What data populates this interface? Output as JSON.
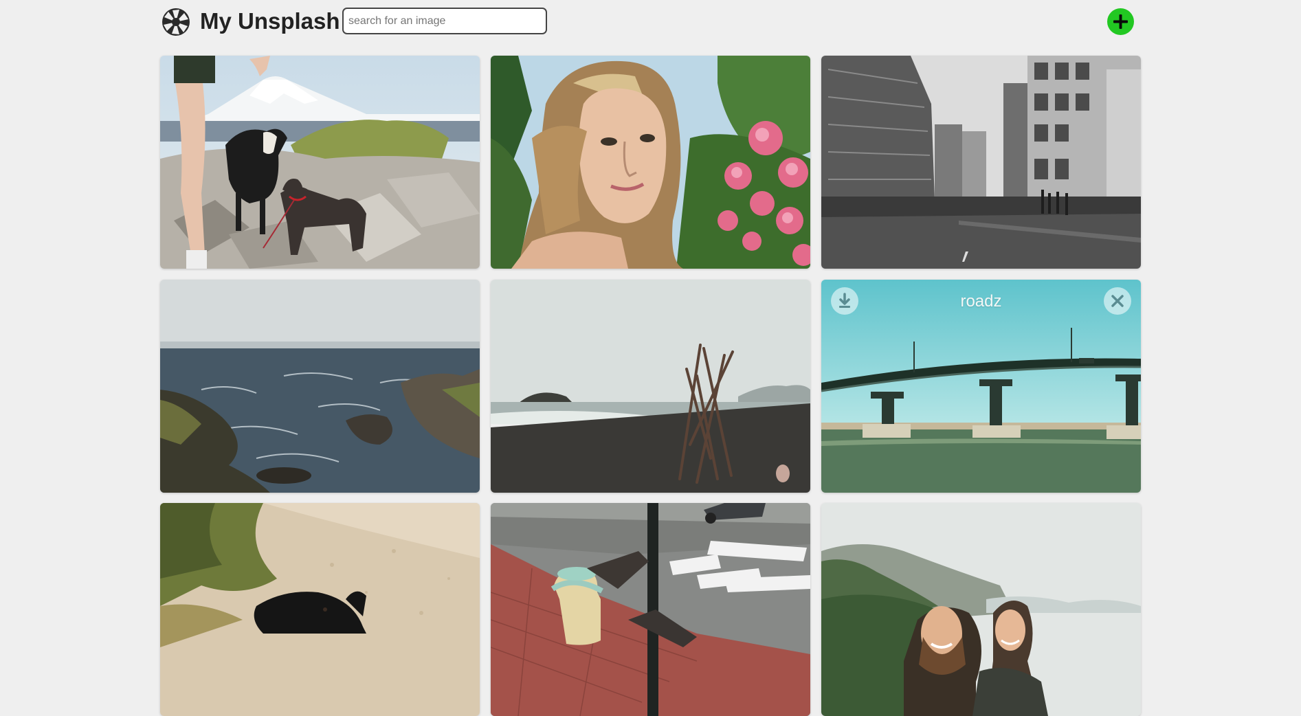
{
  "header": {
    "title": "My Unsplash",
    "search_placeholder": "search for an image",
    "search_value": "",
    "add_icon": "plus-icon",
    "logo_icon": "camera-aperture-icon"
  },
  "colors": {
    "background": "#efefef",
    "add_button": "#22c822",
    "title": "#222222"
  },
  "gallery": {
    "images": [
      {
        "subject": "woman legs with two dogs on rocks, snowy mountain"
      },
      {
        "subject": "portrait of woman with pink flowers"
      },
      {
        "subject": "black and white city street"
      },
      {
        "subject": "rocky ocean coastline"
      },
      {
        "subject": "driftwood teepee on dark beach"
      },
      {
        "subject": "bridge over water",
        "label": "roadz",
        "hovered": true
      },
      {
        "subject": "black dog on dirt path"
      },
      {
        "subject": "fire hydrant and pole on street"
      },
      {
        "subject": "smiling couple at coastal hills"
      }
    ],
    "hover_actions": {
      "download_icon": "download-icon",
      "delete_icon": "close-icon"
    }
  }
}
